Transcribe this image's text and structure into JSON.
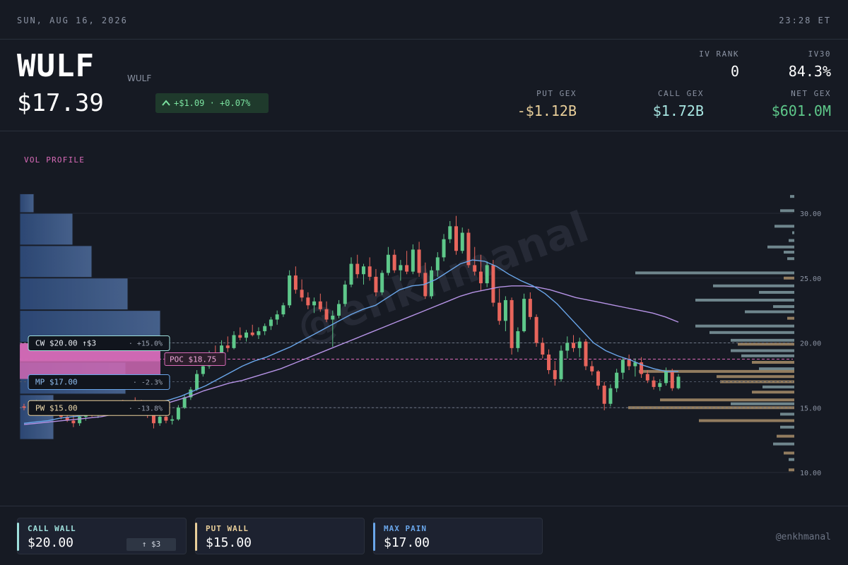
{
  "topbar": {
    "date": "SUN, AUG 16, 2026",
    "time": "23:28 ET"
  },
  "header": {
    "ticker": "WULF",
    "ticker_sub": "WULF",
    "price": "$17.39",
    "change": "+$1.09 · +0.07%",
    "iv_rank_label": "IV RANK",
    "iv_rank": "0",
    "iv30_label": "IV30",
    "iv30": "84.3%",
    "put_gex_label": "PUT GEX",
    "put_gex": "-$1.12B",
    "call_gex_label": "CALL GEX",
    "call_gex": "$1.72B",
    "net_gex_label": "NET GEX",
    "net_gex": "$601.0M"
  },
  "colors": {
    "up": "#5ec88a",
    "down": "#e8655c",
    "call": "#9fe0dc",
    "put": "#e9cf9a",
    "maxpain": "#6aa6ea",
    "poc": "#d96bb8",
    "ma_fast": "#6aa6ea",
    "ma_slow": "#b693e6",
    "gex_put": "#a88e6a",
    "gex_call": "#7f9aa0"
  },
  "chart": {
    "vol_profile_label": "VOL PROFILE",
    "watermark": "@enkhmanal",
    "y_ticks": [
      "30.00",
      "25.00",
      "20.00",
      "15.00",
      "10.00"
    ],
    "levels": {
      "cw": {
        "label": "CW $20.00 ↑$3",
        "pct": "+15.0%"
      },
      "poc": {
        "label": "POC $18.75"
      },
      "mp": {
        "label": "MP $17.00",
        "pct": "-2.3%"
      },
      "pw": {
        "label": "PW $15.00",
        "pct": "-13.8%"
      }
    }
  },
  "chart_data": {
    "type": "candlestick",
    "y_axis": {
      "min": 10,
      "max": 30,
      "ticks": [
        30,
        25,
        20,
        15,
        10
      ]
    },
    "levels": {
      "call_wall": 20.0,
      "poc": 18.75,
      "max_pain": 17.0,
      "put_wall": 15.0
    },
    "candles": [
      [
        15.1,
        15.3,
        14.8,
        15.0
      ],
      [
        15.0,
        15.1,
        14.7,
        14.9
      ],
      [
        14.9,
        15.6,
        14.8,
        15.4
      ],
      [
        15.4,
        15.5,
        14.9,
        15.1
      ],
      [
        15.1,
        15.4,
        14.6,
        14.8
      ],
      [
        14.8,
        15.0,
        14.5,
        14.6
      ],
      [
        14.6,
        14.9,
        14.1,
        14.3
      ],
      [
        14.3,
        14.6,
        13.9,
        14.0
      ],
      [
        14.0,
        14.4,
        13.5,
        13.8
      ],
      [
        13.8,
        14.5,
        13.6,
        14.3
      ],
      [
        14.3,
        14.8,
        14.0,
        14.6
      ],
      [
        14.6,
        15.0,
        14.3,
        14.5
      ],
      [
        14.5,
        14.8,
        14.2,
        14.7
      ],
      [
        14.7,
        15.3,
        14.5,
        15.1
      ],
      [
        15.1,
        15.2,
        14.6,
        14.8
      ],
      [
        14.8,
        15.4,
        14.6,
        15.2
      ],
      [
        15.2,
        15.6,
        14.9,
        15.0
      ],
      [
        15.0,
        15.5,
        14.8,
        15.4
      ],
      [
        15.4,
        15.8,
        15.1,
        15.3
      ],
      [
        15.3,
        15.6,
        15.0,
        15.1
      ],
      [
        15.1,
        15.3,
        14.2,
        14.4
      ],
      [
        14.4,
        14.6,
        13.4,
        13.8
      ],
      [
        13.8,
        14.5,
        13.6,
        14.3
      ],
      [
        14.3,
        14.6,
        13.8,
        14.0
      ],
      [
        14.0,
        14.4,
        13.7,
        14.1
      ],
      [
        14.1,
        15.2,
        14.0,
        15.0
      ],
      [
        15.0,
        16.0,
        14.9,
        15.8
      ],
      [
        15.8,
        16.6,
        15.6,
        16.4
      ],
      [
        16.4,
        17.9,
        16.3,
        17.6
      ],
      [
        17.6,
        18.5,
        17.4,
        18.2
      ],
      [
        18.2,
        19.4,
        18.0,
        19.2
      ],
      [
        19.2,
        19.8,
        18.6,
        18.9
      ],
      [
        18.9,
        20.2,
        18.7,
        19.8
      ],
      [
        19.8,
        20.5,
        19.3,
        19.6
      ],
      [
        19.6,
        20.9,
        19.5,
        20.6
      ],
      [
        20.6,
        21.2,
        20.2,
        20.4
      ],
      [
        20.4,
        21.0,
        20.1,
        20.8
      ],
      [
        20.8,
        21.4,
        20.5,
        20.6
      ],
      [
        20.6,
        21.2,
        20.3,
        20.9
      ],
      [
        20.9,
        21.5,
        20.6,
        21.3
      ],
      [
        21.3,
        22.0,
        21.0,
        21.8
      ],
      [
        21.8,
        22.5,
        21.4,
        22.2
      ],
      [
        22.2,
        23.1,
        22.0,
        22.9
      ],
      [
        22.9,
        25.6,
        22.7,
        25.2
      ],
      [
        25.2,
        25.9,
        23.8,
        24.1
      ],
      [
        24.1,
        24.9,
        23.2,
        23.5
      ],
      [
        23.5,
        23.9,
        22.6,
        22.9
      ],
      [
        22.9,
        23.5,
        22.3,
        23.2
      ],
      [
        23.2,
        23.8,
        22.4,
        22.6
      ],
      [
        22.6,
        23.2,
        21.6,
        21.8
      ],
      [
        21.8,
        22.5,
        19.7,
        22.1
      ],
      [
        22.1,
        23.3,
        21.9,
        23.0
      ],
      [
        23.0,
        24.8,
        22.8,
        24.5
      ],
      [
        24.5,
        26.6,
        24.3,
        26.1
      ],
      [
        26.1,
        26.8,
        25.0,
        25.3
      ],
      [
        25.3,
        26.1,
        24.5,
        25.9
      ],
      [
        25.9,
        26.6,
        24.8,
        25.1
      ],
      [
        25.1,
        25.7,
        23.6,
        23.9
      ],
      [
        23.9,
        25.6,
        23.7,
        25.4
      ],
      [
        25.4,
        27.4,
        25.2,
        26.8
      ],
      [
        26.8,
        27.2,
        25.4,
        25.6
      ],
      [
        25.6,
        26.4,
        24.8,
        26.0
      ],
      [
        26.0,
        27.1,
        25.3,
        25.5
      ],
      [
        25.5,
        27.6,
        25.3,
        27.2
      ],
      [
        27.2,
        27.8,
        25.1,
        25.4
      ],
      [
        25.4,
        26.2,
        23.4,
        23.6
      ],
      [
        23.6,
        25.9,
        23.4,
        25.6
      ],
      [
        25.6,
        27.0,
        25.1,
        26.6
      ],
      [
        26.6,
        28.4,
        26.3,
        28.0
      ],
      [
        28.0,
        29.4,
        27.7,
        29.0
      ],
      [
        29.0,
        29.8,
        26.8,
        27.1
      ],
      [
        27.1,
        28.9,
        26.9,
        28.5
      ],
      [
        28.5,
        28.8,
        25.8,
        26.0
      ],
      [
        26.0,
        27.4,
        25.2,
        25.5
      ],
      [
        25.5,
        26.8,
        24.0,
        24.6
      ],
      [
        24.6,
        26.3,
        24.3,
        26.0
      ],
      [
        26.0,
        26.4,
        22.8,
        23.1
      ],
      [
        23.1,
        24.2,
        21.4,
        21.7
      ],
      [
        21.7,
        23.6,
        20.9,
        23.3
      ],
      [
        23.3,
        23.5,
        19.1,
        19.6
      ],
      [
        19.6,
        21.2,
        19.3,
        20.9
      ],
      [
        20.9,
        23.8,
        20.8,
        23.4
      ],
      [
        23.4,
        23.9,
        21.8,
        22.0
      ],
      [
        22.0,
        22.2,
        19.7,
        20.0
      ],
      [
        20.0,
        20.4,
        18.8,
        19.1
      ],
      [
        19.1,
        19.5,
        17.6,
        17.9
      ],
      [
        17.9,
        18.6,
        16.7,
        17.2
      ],
      [
        17.2,
        19.8,
        17.0,
        19.4
      ],
      [
        19.4,
        20.5,
        18.8,
        20.0
      ],
      [
        20.0,
        20.6,
        19.3,
        19.6
      ],
      [
        19.6,
        20.4,
        18.9,
        20.1
      ],
      [
        20.1,
        20.3,
        17.9,
        18.2
      ],
      [
        18.2,
        18.6,
        17.5,
        17.8
      ],
      [
        17.8,
        17.9,
        16.4,
        16.7
      ],
      [
        16.7,
        17.0,
        14.8,
        15.3
      ],
      [
        15.3,
        16.8,
        15.1,
        16.5
      ],
      [
        16.5,
        18.0,
        16.2,
        17.7
      ],
      [
        17.7,
        18.9,
        17.2,
        18.7
      ],
      [
        18.7,
        19.1,
        17.9,
        18.2
      ],
      [
        18.2,
        18.8,
        17.4,
        18.5
      ],
      [
        18.5,
        18.9,
        17.3,
        17.6
      ],
      [
        17.6,
        17.9,
        16.9,
        17.1
      ],
      [
        17.1,
        17.4,
        16.4,
        16.6
      ],
      [
        16.6,
        17.2,
        16.3,
        16.9
      ],
      [
        16.9,
        18.1,
        16.7,
        17.8
      ],
      [
        17.8,
        18.0,
        16.3,
        16.5
      ],
      [
        16.5,
        17.6,
        16.4,
        17.39
      ]
    ],
    "ma_fast": [
      13.8,
      13.9,
      14.0,
      14.2,
      14.3,
      14.4,
      14.5,
      14.6,
      14.7,
      14.9,
      15.1,
      15.4,
      15.6,
      15.9,
      16.3,
      16.7,
      17.2,
      17.7,
      18.2,
      18.6,
      18.9,
      19.3,
      19.7,
      20.2,
      20.7,
      21.2,
      21.7,
      22.2,
      22.6,
      22.9,
      23.5,
      24.1,
      24.4,
      24.5,
      24.9,
      25.5,
      26.1,
      26.4,
      26.3,
      25.9,
      25.3,
      24.8,
      24.4,
      23.8,
      23.0,
      22.0,
      21.0,
      20.0,
      19.4,
      19.0,
      18.7,
      18.3,
      18.0,
      17.8,
      17.8
    ],
    "ma_slow": [
      13.7,
      13.8,
      13.9,
      14.0,
      14.1,
      14.2,
      14.3,
      14.5,
      14.6,
      14.8,
      15.0,
      15.3,
      15.6,
      15.9,
      16.3,
      16.6,
      16.9,
      17.1,
      17.4,
      17.7,
      18.0,
      18.4,
      18.8,
      19.2,
      19.6,
      20.0,
      20.4,
      20.8,
      21.2,
      21.6,
      22.0,
      22.4,
      22.8,
      23.2,
      23.6,
      23.9,
      24.1,
      24.3,
      24.4,
      24.4,
      24.3,
      24.1,
      23.8,
      23.5,
      23.3,
      23.1,
      22.9,
      22.7,
      22.5,
      22.3,
      22.0,
      21.6
    ]
  },
  "footer": {
    "call_wall_label": "CALL WALL",
    "call_wall": "$20.00",
    "call_wall_change": "↑ $3",
    "put_wall_label": "PUT WALL",
    "put_wall": "$15.00",
    "max_pain_label": "MAX PAIN",
    "max_pain": "$17.00",
    "handle": "@enkhmanal"
  }
}
